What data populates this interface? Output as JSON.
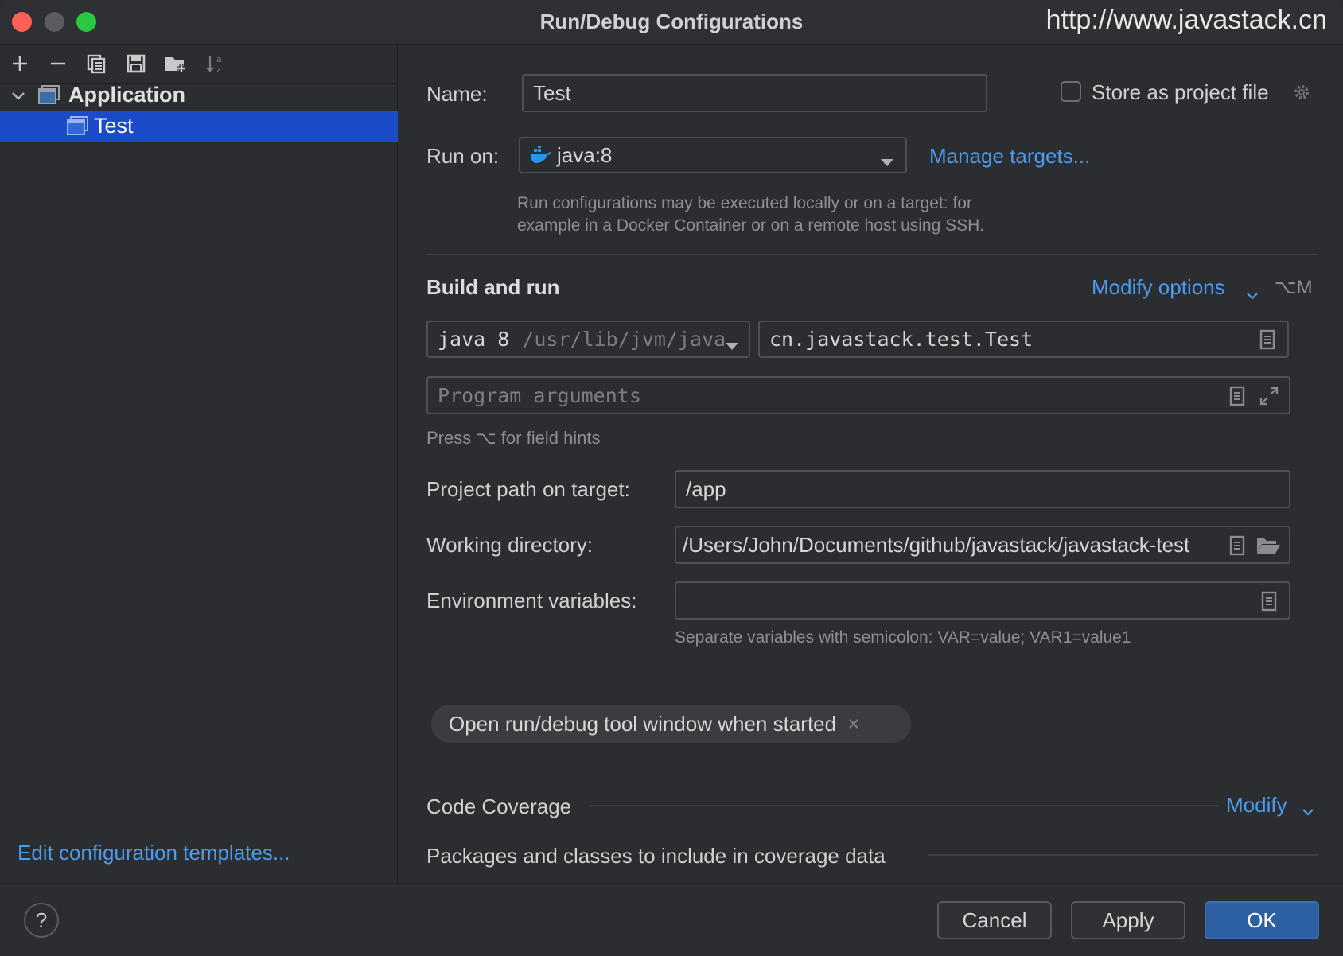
{
  "window": {
    "title": "Run/Debug Configurations",
    "watermark": "http://www.javastack.cn"
  },
  "toolbar": {
    "icons": [
      "plus-icon",
      "minus-icon",
      "copy-icon",
      "save-icon",
      "folder-add-icon",
      "sort-icon"
    ]
  },
  "tree": {
    "group_label": "Application",
    "item_label": "Test"
  },
  "sidebar": {
    "edit_templates": "Edit configuration templates..."
  },
  "form": {
    "name_label": "Name:",
    "name_value": "Test",
    "store_label": "Store as project file",
    "run_on_label": "Run on:",
    "run_on_value": "java:8",
    "manage_targets": "Manage targets...",
    "run_on_hint_1": "Run configurations may be executed locally or on a target: for",
    "run_on_hint_2": "example in a Docker Container or on a remote host using SSH.",
    "build_run_title": "Build and run",
    "modify_options": "Modify options",
    "modify_shortcut": "⌥M",
    "jdk_name": "java 8",
    "jdk_path": "/usr/lib/jvm/java",
    "main_class": "cn.javastack.test.Test",
    "program_args_placeholder": "Program arguments",
    "field_hints": "Press ⌥ for field hints",
    "project_path_label": "Project path on target:",
    "project_path_value": "/app",
    "working_dir_label": "Working directory:",
    "working_dir_value": "/Users/John/Documents/github/javastack/javastack-test",
    "env_label": "Environment variables:",
    "env_value": "",
    "env_hint": "Separate variables with semicolon: VAR=value; VAR1=value1",
    "chip_label": "Open run/debug tool window when started",
    "coverage_title": "Code Coverage",
    "coverage_modify": "Modify",
    "coverage_packages": "Packages and classes to include in coverage data"
  },
  "buttons": {
    "help": "?",
    "cancel": "Cancel",
    "apply": "Apply",
    "ok": "OK"
  },
  "colors": {
    "accent": "#4a9cf0",
    "selection": "#1b4bc9",
    "primary_button": "#2d5fa3",
    "background": "#2b2d30"
  }
}
